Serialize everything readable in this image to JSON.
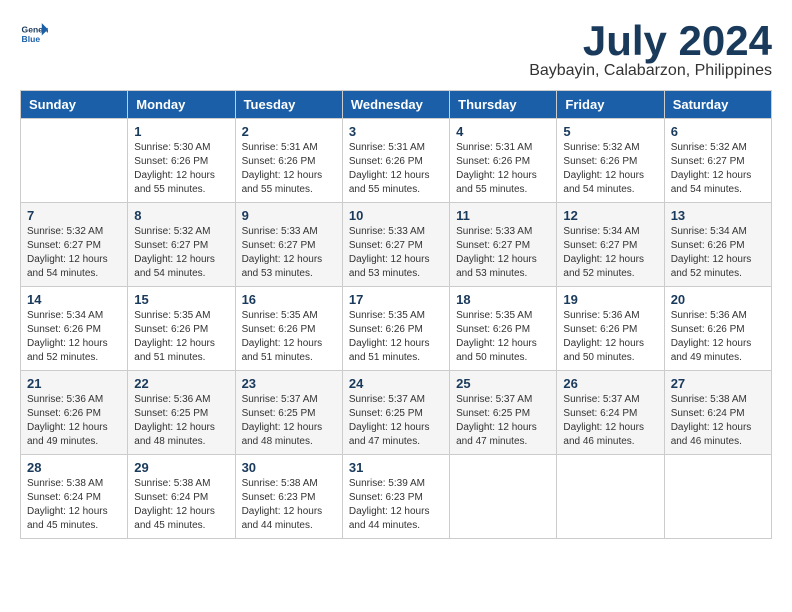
{
  "header": {
    "logo_line1": "General",
    "logo_line2": "Blue",
    "month": "July 2024",
    "location": "Baybayin, Calabarzon, Philippines"
  },
  "days_of_week": [
    "Sunday",
    "Monday",
    "Tuesday",
    "Wednesday",
    "Thursday",
    "Friday",
    "Saturday"
  ],
  "weeks": [
    [
      {
        "day": "",
        "info": ""
      },
      {
        "day": "1",
        "info": "Sunrise: 5:30 AM\nSunset: 6:26 PM\nDaylight: 12 hours\nand 55 minutes."
      },
      {
        "day": "2",
        "info": "Sunrise: 5:31 AM\nSunset: 6:26 PM\nDaylight: 12 hours\nand 55 minutes."
      },
      {
        "day": "3",
        "info": "Sunrise: 5:31 AM\nSunset: 6:26 PM\nDaylight: 12 hours\nand 55 minutes."
      },
      {
        "day": "4",
        "info": "Sunrise: 5:31 AM\nSunset: 6:26 PM\nDaylight: 12 hours\nand 55 minutes."
      },
      {
        "day": "5",
        "info": "Sunrise: 5:32 AM\nSunset: 6:26 PM\nDaylight: 12 hours\nand 54 minutes."
      },
      {
        "day": "6",
        "info": "Sunrise: 5:32 AM\nSunset: 6:27 PM\nDaylight: 12 hours\nand 54 minutes."
      }
    ],
    [
      {
        "day": "7",
        "info": "Sunrise: 5:32 AM\nSunset: 6:27 PM\nDaylight: 12 hours\nand 54 minutes."
      },
      {
        "day": "8",
        "info": "Sunrise: 5:32 AM\nSunset: 6:27 PM\nDaylight: 12 hours\nand 54 minutes."
      },
      {
        "day": "9",
        "info": "Sunrise: 5:33 AM\nSunset: 6:27 PM\nDaylight: 12 hours\nand 53 minutes."
      },
      {
        "day": "10",
        "info": "Sunrise: 5:33 AM\nSunset: 6:27 PM\nDaylight: 12 hours\nand 53 minutes."
      },
      {
        "day": "11",
        "info": "Sunrise: 5:33 AM\nSunset: 6:27 PM\nDaylight: 12 hours\nand 53 minutes."
      },
      {
        "day": "12",
        "info": "Sunrise: 5:34 AM\nSunset: 6:27 PM\nDaylight: 12 hours\nand 52 minutes."
      },
      {
        "day": "13",
        "info": "Sunrise: 5:34 AM\nSunset: 6:26 PM\nDaylight: 12 hours\nand 52 minutes."
      }
    ],
    [
      {
        "day": "14",
        "info": "Sunrise: 5:34 AM\nSunset: 6:26 PM\nDaylight: 12 hours\nand 52 minutes."
      },
      {
        "day": "15",
        "info": "Sunrise: 5:35 AM\nSunset: 6:26 PM\nDaylight: 12 hours\nand 51 minutes."
      },
      {
        "day": "16",
        "info": "Sunrise: 5:35 AM\nSunset: 6:26 PM\nDaylight: 12 hours\nand 51 minutes."
      },
      {
        "day": "17",
        "info": "Sunrise: 5:35 AM\nSunset: 6:26 PM\nDaylight: 12 hours\nand 51 minutes."
      },
      {
        "day": "18",
        "info": "Sunrise: 5:35 AM\nSunset: 6:26 PM\nDaylight: 12 hours\nand 50 minutes."
      },
      {
        "day": "19",
        "info": "Sunrise: 5:36 AM\nSunset: 6:26 PM\nDaylight: 12 hours\nand 50 minutes."
      },
      {
        "day": "20",
        "info": "Sunrise: 5:36 AM\nSunset: 6:26 PM\nDaylight: 12 hours\nand 49 minutes."
      }
    ],
    [
      {
        "day": "21",
        "info": "Sunrise: 5:36 AM\nSunset: 6:26 PM\nDaylight: 12 hours\nand 49 minutes."
      },
      {
        "day": "22",
        "info": "Sunrise: 5:36 AM\nSunset: 6:25 PM\nDaylight: 12 hours\nand 48 minutes."
      },
      {
        "day": "23",
        "info": "Sunrise: 5:37 AM\nSunset: 6:25 PM\nDaylight: 12 hours\nand 48 minutes."
      },
      {
        "day": "24",
        "info": "Sunrise: 5:37 AM\nSunset: 6:25 PM\nDaylight: 12 hours\nand 47 minutes."
      },
      {
        "day": "25",
        "info": "Sunrise: 5:37 AM\nSunset: 6:25 PM\nDaylight: 12 hours\nand 47 minutes."
      },
      {
        "day": "26",
        "info": "Sunrise: 5:37 AM\nSunset: 6:24 PM\nDaylight: 12 hours\nand 46 minutes."
      },
      {
        "day": "27",
        "info": "Sunrise: 5:38 AM\nSunset: 6:24 PM\nDaylight: 12 hours\nand 46 minutes."
      }
    ],
    [
      {
        "day": "28",
        "info": "Sunrise: 5:38 AM\nSunset: 6:24 PM\nDaylight: 12 hours\nand 45 minutes."
      },
      {
        "day": "29",
        "info": "Sunrise: 5:38 AM\nSunset: 6:24 PM\nDaylight: 12 hours\nand 45 minutes."
      },
      {
        "day": "30",
        "info": "Sunrise: 5:38 AM\nSunset: 6:23 PM\nDaylight: 12 hours\nand 44 minutes."
      },
      {
        "day": "31",
        "info": "Sunrise: 5:39 AM\nSunset: 6:23 PM\nDaylight: 12 hours\nand 44 minutes."
      },
      {
        "day": "",
        "info": ""
      },
      {
        "day": "",
        "info": ""
      },
      {
        "day": "",
        "info": ""
      }
    ]
  ]
}
